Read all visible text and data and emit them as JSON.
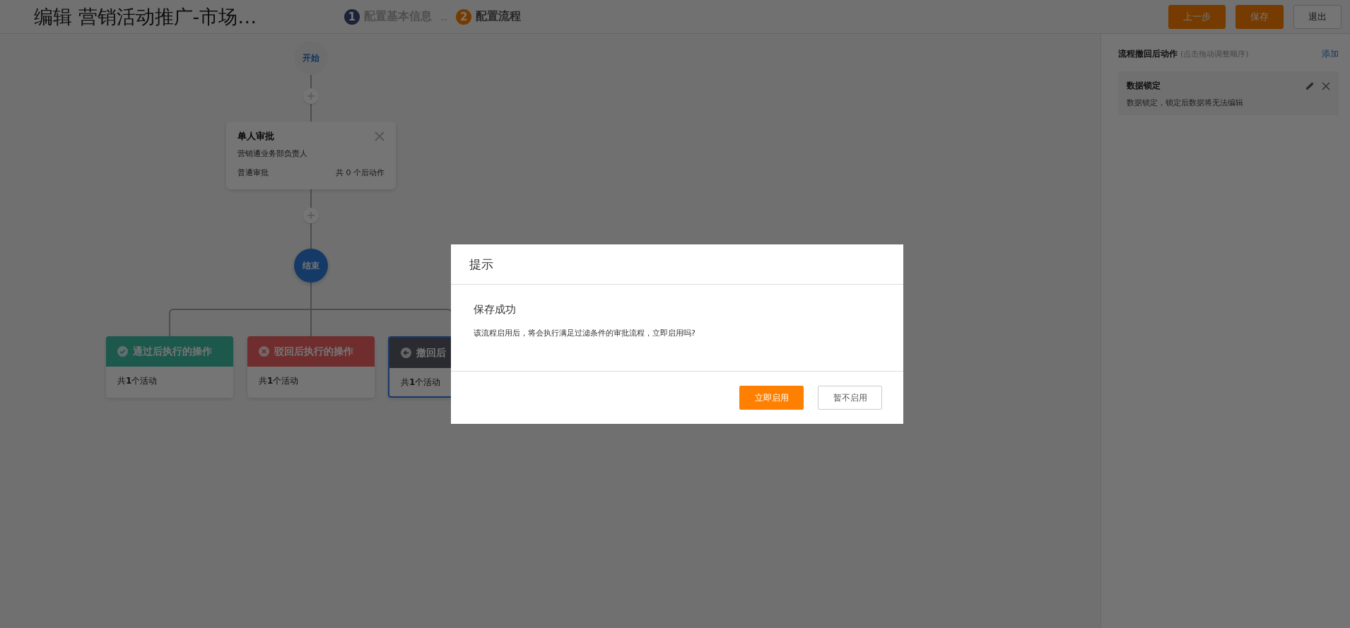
{
  "header": {
    "title": "编辑 营销活动推广-市场…",
    "steps": [
      {
        "number": "1",
        "label": "配置基本信息",
        "selected": false
      },
      {
        "number": "2",
        "label": "配置流程",
        "selected": true
      }
    ],
    "step_separator": "..",
    "buttons": [
      {
        "label": "上一步",
        "kind": "primary"
      },
      {
        "label": "保存",
        "kind": "primary"
      },
      {
        "label": "退出",
        "kind": "default"
      }
    ]
  },
  "flow": {
    "start": "开始",
    "approval_node": {
      "title": "单人审批",
      "approver": "营销通业务部负责人",
      "type": "普通审批",
      "actions": "共 0 个后动作"
    },
    "end": "结束",
    "outcomes": [
      {
        "kind": "approve",
        "title": "通过后执行的操作",
        "summary": "共**1**个活动",
        "selected": false
      },
      {
        "kind": "reject",
        "title": "驳回后执行的操作",
        "summary": "共**1**个活动",
        "selected": false
      },
      {
        "kind": "withdraw",
        "title": "撤回后",
        "summary": "共**1**个活动",
        "selected": true
      }
    ]
  },
  "side_panel": {
    "title": "流程撤回后动作",
    "hint": "(点击拖动调整顺序)",
    "add_link": "添加",
    "actions": [
      {
        "name": "数据锁定",
        "description": "数据锁定，锁定后数据将无法编辑"
      }
    ]
  },
  "dialog": {
    "title": "提示",
    "heading": "保存成功",
    "message": "该流程启用后，将会执行满足过滤条件的审批流程，立即启用吗?",
    "buttons": [
      {
        "label": "立即启用",
        "kind": "primary"
      },
      {
        "label": "暂不启用",
        "kind": "default"
      }
    ]
  }
}
